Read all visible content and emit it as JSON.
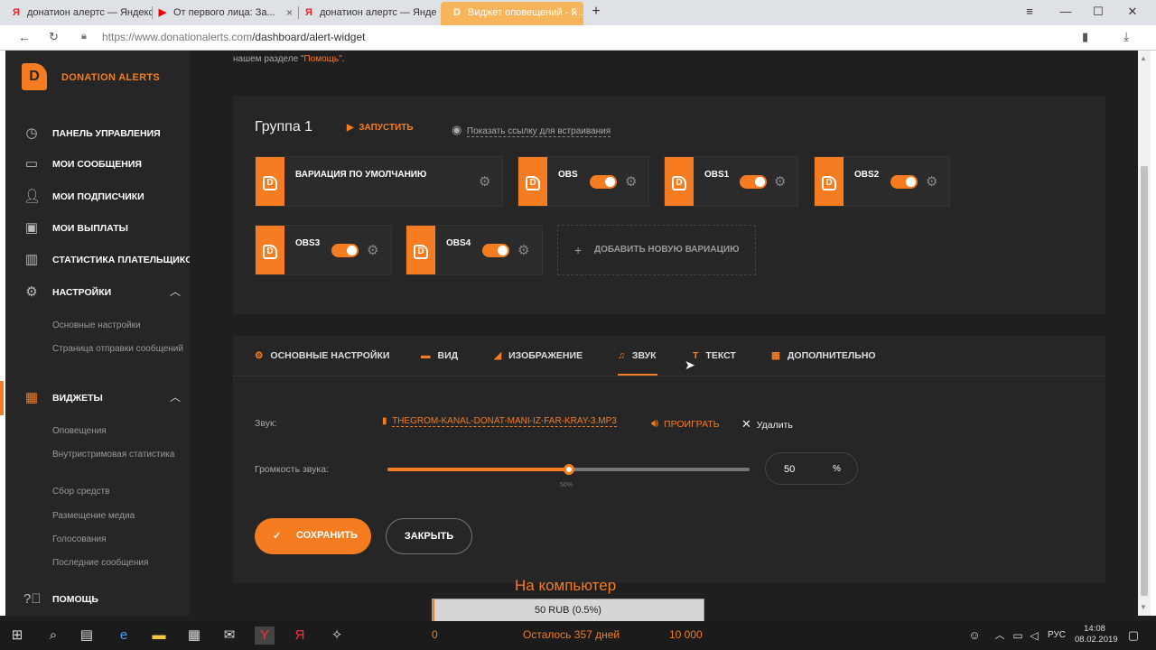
{
  "browser": {
    "tabs": [
      {
        "title": "донатион алертс — Яндекс",
        "icon": "yandex-icon"
      },
      {
        "title": "От первого лица: За...",
        "icon": "youtube-icon"
      },
      {
        "title": "донатион алертс — Яндекс",
        "icon": "yandex-icon"
      },
      {
        "title": "Виджет оповещений - Г...",
        "icon": "donationalerts-icon"
      }
    ],
    "url_host": "https://www.donationalerts.com",
    "url_path": "/dashboard/alert-widget"
  },
  "brand": {
    "name": "DONATION ALERTS",
    "accent": "#f57c20"
  },
  "sidebar": {
    "items": [
      {
        "label": "ПАНЕЛЬ УПРАВЛЕНИЯ",
        "icon": "gauge-icon"
      },
      {
        "label": "МОИ СООБЩЕНИЯ",
        "icon": "message-icon"
      },
      {
        "label": "МОИ ПОДПИСЧИКИ",
        "icon": "user-icon"
      },
      {
        "label": "МОИ ВЫПЛАТЫ",
        "icon": "wallet-icon"
      },
      {
        "label": "СТАТИСТИКА ПЛАТЕЛЬЩИКОВ",
        "icon": "stats-icon"
      },
      {
        "label": "НАСТРОЙКИ",
        "icon": "gear-icon"
      },
      {
        "label": "ВИДЖЕТЫ",
        "icon": "widgets-icon"
      },
      {
        "label": "ПОМОЩЬ",
        "icon": "help-icon"
      }
    ],
    "settings_sub": [
      "Основные настройки",
      "Страница отправки сообщений"
    ],
    "widgets_sub": [
      "Оповещения",
      "Внутристримовая статистика",
      "Сбор средств",
      "Размещение медиа",
      "Голосования",
      "Последние сообщения"
    ]
  },
  "help_note": {
    "prefix": "нашем разделе ",
    "link": "\"Помощь\"",
    "suffix": "."
  },
  "group": {
    "title": "Группа 1",
    "launch_label": "ЗАПУСТИТЬ",
    "embed_link_label": "Показать ссылку для встраивания",
    "variations": [
      {
        "name": "ВАРИАЦИЯ ПО УМОЛЧАНИЮ",
        "toggle": null
      },
      {
        "name": "OBS",
        "toggle": true
      },
      {
        "name": "OBS1",
        "toggle": true
      },
      {
        "name": "OBS2",
        "toggle": true
      },
      {
        "name": "OBS3",
        "toggle": true
      },
      {
        "name": "OBS4",
        "toggle": true
      }
    ],
    "add_variation_label": "ДОБАВИТЬ НОВУЮ ВАРИАЦИЮ"
  },
  "settings_tabs": [
    {
      "label": "ОСНОВНЫЕ НАСТРОЙКИ",
      "icon": "gear-icon"
    },
    {
      "label": "ВИД",
      "icon": "film-icon"
    },
    {
      "label": "ИЗОБРАЖЕНИЕ",
      "icon": "image-icon"
    },
    {
      "label": "ЗВУК",
      "icon": "music-icon",
      "active": true
    },
    {
      "label": "ТЕКСТ",
      "icon": "text-icon"
    },
    {
      "label": "ДОПОЛНИТЕЛЬНО",
      "icon": "grid-icon"
    }
  ],
  "sound": {
    "label": "Звук:",
    "file": "THEGROM-KANAL-DONAT-MANI-IZ-FAR-KRAY-3.MP3",
    "play_label": "ПРОИГРАТЬ",
    "delete_label": "Удалить"
  },
  "volume": {
    "label": "Громкость звука:",
    "value": 50,
    "value_text": "50",
    "unit": "%",
    "tick_text": "50%"
  },
  "actions": {
    "save_label": "СОХРАНИТЬ",
    "close_label": "ЗАКРЫТЬ"
  },
  "overlay": {
    "title": "На компьютер",
    "progress_text": "50 RUB (0.5%)",
    "progress_fraction": 0.005,
    "min": "0",
    "remaining": "Осталось 357 дней",
    "max": "10 000"
  },
  "taskbar": {
    "lang": "РУС",
    "time": "14:08",
    "date": "08.02.2019"
  }
}
